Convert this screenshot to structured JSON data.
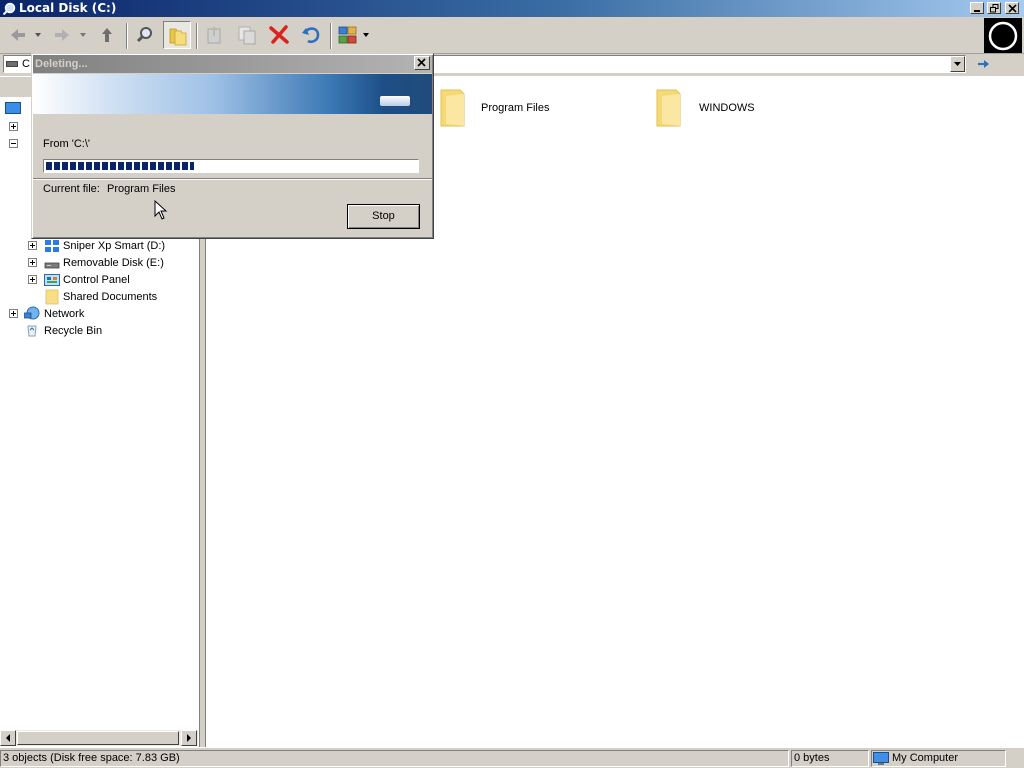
{
  "window": {
    "title": "Local Disk (C:)",
    "caption_buttons": [
      "minimize-icon",
      "restore-icon",
      "close-icon"
    ]
  },
  "toolbar": {
    "buttons": [
      {
        "name": "back",
        "icon": "back-arrow-icon",
        "enabled": false
      },
      {
        "name": "forward",
        "icon": "forward-arrow-icon",
        "enabled": false
      },
      {
        "name": "up",
        "icon": "up-arrow-icon",
        "enabled": true
      },
      {
        "name": "search",
        "icon": "search-icon",
        "enabled": true
      },
      {
        "name": "folders",
        "icon": "folders-icon",
        "enabled": true,
        "pressed": true
      },
      {
        "name": "move-to",
        "icon": "move-to-icon",
        "enabled": false
      },
      {
        "name": "copy-to",
        "icon": "copy-to-icon",
        "enabled": false
      },
      {
        "name": "delete",
        "icon": "delete-icon",
        "enabled": true
      },
      {
        "name": "undo",
        "icon": "undo-icon",
        "enabled": true
      },
      {
        "name": "views",
        "icon": "views-icon",
        "enabled": true
      }
    ],
    "throbber_icon": "windows-logo-throbber"
  },
  "address_bar": {
    "value": "C:",
    "icon": "drive-icon",
    "go_icon": "go-arrow-icon"
  },
  "tree": {
    "items": [
      {
        "label": "Sniper Xp Smart (D:)",
        "icon": "cd-drive-icon",
        "expander": "plus"
      },
      {
        "label": "Removable Disk (E:)",
        "icon": "removable-disk-icon",
        "expander": "plus"
      },
      {
        "label": "Control Panel",
        "icon": "control-panel-icon",
        "expander": "plus"
      },
      {
        "label": "Shared Documents",
        "icon": "folder-icon",
        "expander": "none"
      },
      {
        "label": "Network",
        "icon": "network-icon",
        "expander": "plus"
      },
      {
        "label": "Recycle Bin",
        "icon": "recycle-bin-icon",
        "expander": "none"
      }
    ]
  },
  "content": {
    "items": [
      {
        "label": "Program Files",
        "icon": "folder-icon"
      },
      {
        "label": "WINDOWS",
        "icon": "folder-icon"
      }
    ]
  },
  "dialog": {
    "title": "Deleting...",
    "from_text": "From 'C:\\'",
    "progress_fraction": 0.4,
    "current_file_label": "Current file:",
    "current_file_value": "Program Files",
    "stop_label": "Stop"
  },
  "status_bar": {
    "objects_text": "3 objects (Disk free space: 7.83 GB)",
    "size_text": "0 bytes",
    "zone_text": "My Computer",
    "zone_icon": "my-computer-icon"
  },
  "colors": {
    "title_bar_start": "#0a246a",
    "title_bar_end": "#a6caf0",
    "chrome": "#d4d0c8",
    "progress": "#0a246a",
    "folder": "#f5d76e"
  }
}
